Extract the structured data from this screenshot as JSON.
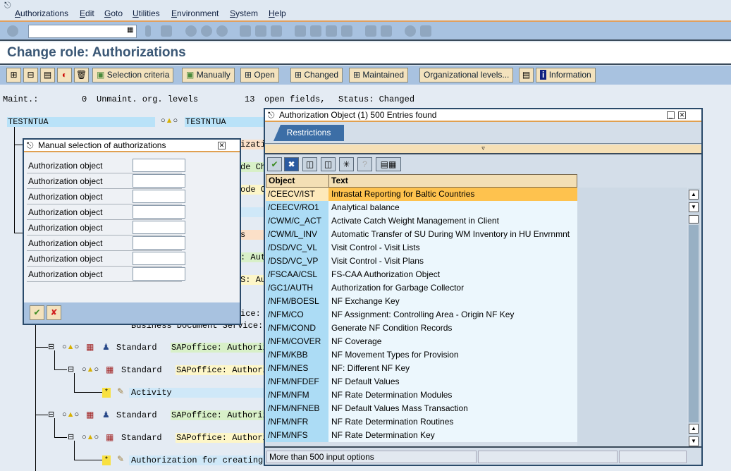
{
  "menu": [
    "Authorizations",
    "Edit",
    "Goto",
    "Utilities",
    "Environment",
    "System",
    "Help"
  ],
  "command_field": {
    "value": ""
  },
  "title": "Change role: Authorizations",
  "app_toolbar": {
    "selection_criteria": "Selection criteria",
    "manually": "Manually",
    "open": "Open",
    "changed": "Changed",
    "maintained": "Maintained",
    "org_levels": "Organizational levels...",
    "information": "Information"
  },
  "status_line": {
    "maint_label": "Maint.:",
    "maint_count": "0",
    "unmaint_label": "Unmaint. org. levels",
    "open_count": "13",
    "open_label": "open fields,",
    "status": "Status: Changed"
  },
  "tree": {
    "root": "TESTNTUA",
    "root_text": "TESTNTUA",
    "fragments": [
      "izati",
      "de Ch",
      "ode C",
      "s",
      ": Aut",
      "S: Au",
      "ice:"
    ],
    "bds": "Business Document Service:",
    "rows": [
      {
        "name": "Standard",
        "text": "SAPoffice: Authoriz"
      },
      {
        "name": "Standard",
        "text": "SAPoffice: Authori"
      },
      {
        "name": "Activity"
      },
      {
        "name": "Standard",
        "text": "SAPoffice: Authoriz"
      },
      {
        "name": "Standard",
        "text": "SAPoffice: Authori"
      },
      {
        "name": "Authorization for creating"
      }
    ]
  },
  "manual_dialog": {
    "title": "Manual selection of authorizations",
    "fields": [
      "Authorization object",
      "Authorization object",
      "Authorization object",
      "Authorization object",
      "Authorization object",
      "Authorization object",
      "Authorization object",
      "Authorization object"
    ],
    "values": [
      "",
      "",
      "",
      "",
      "",
      "",
      "",
      ""
    ]
  },
  "search_dialog": {
    "title": "Authorization Object (1)  500 Entries found",
    "tab": "Restrictions",
    "columns": [
      "Object",
      "Text"
    ],
    "rows": [
      [
        "/CEECV/IST",
        "Intrastat Reporting for Baltic Countries"
      ],
      [
        "/CEECV/RO1",
        "Analytical balance"
      ],
      [
        "/CWM/C_ACT",
        "Activate Catch Weight Management in Client"
      ],
      [
        "/CWM/L_INV",
        "Automatic Transfer of SU During WM Inventory in HU Envrnmnt"
      ],
      [
        "/DSD/VC_VL",
        "Visit Control - Visit Lists"
      ],
      [
        "/DSD/VC_VP",
        "Visit Control - Visit Plans"
      ],
      [
        "/FSCAA/CSL",
        "FS-CAA Authorization Object"
      ],
      [
        "/GC1/AUTH",
        "Authorization for Garbage Collector"
      ],
      [
        "/NFM/BOESL",
        "NF Exchange Key"
      ],
      [
        "/NFM/CO",
        "NF Assignment: Controlling Area - Origin NF Key"
      ],
      [
        "/NFM/COND",
        "Generate NF Condition Records"
      ],
      [
        "/NFM/COVER",
        "NF Coverage"
      ],
      [
        "/NFM/KBB",
        "NF Movement Types for Provision"
      ],
      [
        "/NFM/NES",
        "NF: Different NF Key"
      ],
      [
        "/NFM/NFDEF",
        "NF Default Values"
      ],
      [
        "/NFM/NFM",
        "NF Rate Determination Modules"
      ],
      [
        "/NFM/NFNEB",
        "NF Default Values Mass Transaction"
      ],
      [
        "/NFM/NFR",
        "NF Rate Determination Routines"
      ],
      [
        "/NFM/NFS",
        "NF Rate Determination Key"
      ]
    ],
    "selected_row": 0,
    "status": "More than  500 input options"
  },
  "colors": {
    "toolbar": "#a8c2e0",
    "button": "#f3e2bd",
    "selected": "#fec24e",
    "object_col": "#acdcf5",
    "tab": "#3c6ea6"
  }
}
